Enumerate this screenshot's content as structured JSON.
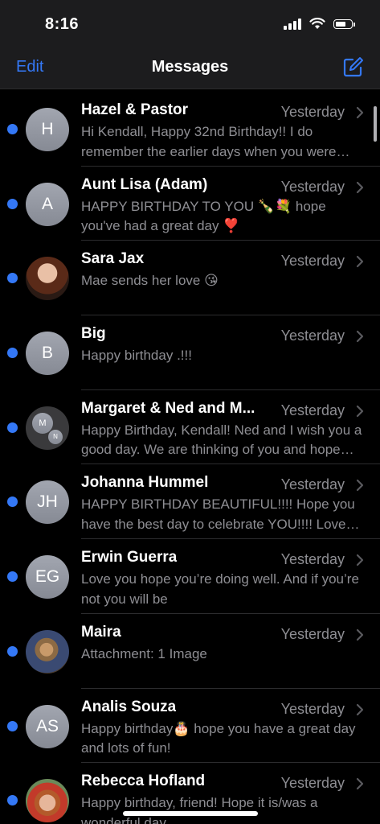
{
  "status_bar": {
    "time": "8:16",
    "battery_level": 0.7
  },
  "nav": {
    "edit_label": "Edit",
    "title": "Messages",
    "compose_icon": "compose-icon"
  },
  "colors": {
    "accent": "#3478f6",
    "secondary_text": "#8e8e93",
    "background": "#000000"
  },
  "conversations": [
    {
      "name": "Hazel & Pastor",
      "time": "Yesterday",
      "preview": " Hi Kendall, Happy 32nd Birthday!! I do remember the earlier days when you were little and so full of joy",
      "unread": true,
      "avatar": {
        "type": "initials",
        "initials": "H"
      }
    },
    {
      "name": "Aunt Lisa (Adam)",
      "time": "Yesterday",
      "preview": "HAPPY BIRTHDAY TO YOU 🍾💐 hope you've had a great day ❣️",
      "unread": true,
      "avatar": {
        "type": "initials",
        "initials": "A"
      }
    },
    {
      "name": "Sara Jax",
      "time": "Yesterday",
      "preview": "Mae sends her love 😘",
      "unread": true,
      "avatar": {
        "type": "photo",
        "initials": ""
      }
    },
    {
      "name": "Big",
      "time": "Yesterday",
      "preview": "Happy birthday .!!!",
      "unread": true,
      "avatar": {
        "type": "initials",
        "initials": "B"
      }
    },
    {
      "name": "Margaret & Ned and M...",
      "time": "Yesterday",
      "preview": "Happy Birthday, Kendall! Ned and I wish you a good day. We are thinking of you and hope the year ahead is great",
      "unread": true,
      "avatar": {
        "type": "group",
        "initials": "M",
        "initials2": "N"
      }
    },
    {
      "name": "Johanna Hummel",
      "time": "Yesterday",
      "preview": "HAPPY BIRTHDAY BEAUTIFUL!!!! Hope you have the best day to celebrate YOU!!!! Love you so much",
      "unread": true,
      "avatar": {
        "type": "initials",
        "initials": "JH"
      }
    },
    {
      "name": "Erwin Guerra",
      "time": "Yesterday",
      "preview": "Love you hope you’re doing well. And if you’re not you will be",
      "unread": true,
      "avatar": {
        "type": "initials",
        "initials": "EG"
      }
    },
    {
      "name": "Maira",
      "time": "Yesterday",
      "preview": "Attachment: 1 Image",
      "unread": true,
      "avatar": {
        "type": "photo",
        "initials": ""
      }
    },
    {
      "name": "Analis Souza",
      "time": "Yesterday",
      "preview": "Happy birthday🎂 hope you have a great day and lots of fun!",
      "unread": true,
      "avatar": {
        "type": "initials",
        "initials": "AS"
      }
    },
    {
      "name": "Rebecca Hofland",
      "time": "Yesterday",
      "preview": "Happy birthday, friend! Hope it is/was a wonderful day",
      "unread": true,
      "avatar": {
        "type": "photo",
        "initials": ""
      }
    }
  ]
}
